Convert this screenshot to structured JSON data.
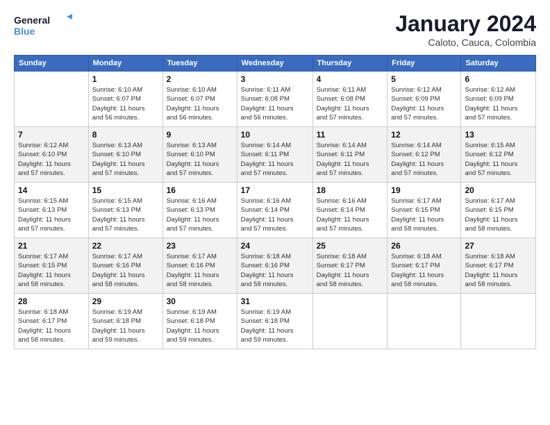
{
  "logo": {
    "line1": "General",
    "line2": "Blue"
  },
  "title": "January 2024",
  "location": "Caloto, Cauca, Colombia",
  "weekdays": [
    "Sunday",
    "Monday",
    "Tuesday",
    "Wednesday",
    "Thursday",
    "Friday",
    "Saturday"
  ],
  "weeks": [
    [
      {
        "day": "",
        "info": ""
      },
      {
        "day": "1",
        "info": "Sunrise: 6:10 AM\nSunset: 6:07 PM\nDaylight: 11 hours\nand 56 minutes."
      },
      {
        "day": "2",
        "info": "Sunrise: 6:10 AM\nSunset: 6:07 PM\nDaylight: 11 hours\nand 56 minutes."
      },
      {
        "day": "3",
        "info": "Sunrise: 6:11 AM\nSunset: 6:08 PM\nDaylight: 11 hours\nand 56 minutes."
      },
      {
        "day": "4",
        "info": "Sunrise: 6:11 AM\nSunset: 6:08 PM\nDaylight: 11 hours\nand 57 minutes."
      },
      {
        "day": "5",
        "info": "Sunrise: 6:12 AM\nSunset: 6:09 PM\nDaylight: 11 hours\nand 57 minutes."
      },
      {
        "day": "6",
        "info": "Sunrise: 6:12 AM\nSunset: 6:09 PM\nDaylight: 11 hours\nand 57 minutes."
      }
    ],
    [
      {
        "day": "7",
        "info": "Sunrise: 6:12 AM\nSunset: 6:10 PM\nDaylight: 11 hours\nand 57 minutes."
      },
      {
        "day": "8",
        "info": "Sunrise: 6:13 AM\nSunset: 6:10 PM\nDaylight: 11 hours\nand 57 minutes."
      },
      {
        "day": "9",
        "info": "Sunrise: 6:13 AM\nSunset: 6:10 PM\nDaylight: 11 hours\nand 57 minutes."
      },
      {
        "day": "10",
        "info": "Sunrise: 6:14 AM\nSunset: 6:11 PM\nDaylight: 11 hours\nand 57 minutes."
      },
      {
        "day": "11",
        "info": "Sunrise: 6:14 AM\nSunset: 6:11 PM\nDaylight: 11 hours\nand 57 minutes."
      },
      {
        "day": "12",
        "info": "Sunrise: 6:14 AM\nSunset: 6:12 PM\nDaylight: 11 hours\nand 57 minutes."
      },
      {
        "day": "13",
        "info": "Sunrise: 6:15 AM\nSunset: 6:12 PM\nDaylight: 11 hours\nand 57 minutes."
      }
    ],
    [
      {
        "day": "14",
        "info": "Sunrise: 6:15 AM\nSunset: 6:13 PM\nDaylight: 11 hours\nand 57 minutes."
      },
      {
        "day": "15",
        "info": "Sunrise: 6:15 AM\nSunset: 6:13 PM\nDaylight: 11 hours\nand 57 minutes."
      },
      {
        "day": "16",
        "info": "Sunrise: 6:16 AM\nSunset: 6:13 PM\nDaylight: 11 hours\nand 57 minutes."
      },
      {
        "day": "17",
        "info": "Sunrise: 6:16 AM\nSunset: 6:14 PM\nDaylight: 11 hours\nand 57 minutes."
      },
      {
        "day": "18",
        "info": "Sunrise: 6:16 AM\nSunset: 6:14 PM\nDaylight: 11 hours\nand 57 minutes."
      },
      {
        "day": "19",
        "info": "Sunrise: 6:17 AM\nSunset: 6:15 PM\nDaylight: 11 hours\nand 58 minutes."
      },
      {
        "day": "20",
        "info": "Sunrise: 6:17 AM\nSunset: 6:15 PM\nDaylight: 11 hours\nand 58 minutes."
      }
    ],
    [
      {
        "day": "21",
        "info": "Sunrise: 6:17 AM\nSunset: 6:15 PM\nDaylight: 11 hours\nand 58 minutes."
      },
      {
        "day": "22",
        "info": "Sunrise: 6:17 AM\nSunset: 6:16 PM\nDaylight: 11 hours\nand 58 minutes."
      },
      {
        "day": "23",
        "info": "Sunrise: 6:17 AM\nSunset: 6:16 PM\nDaylight: 11 hours\nand 58 minutes."
      },
      {
        "day": "24",
        "info": "Sunrise: 6:18 AM\nSunset: 6:16 PM\nDaylight: 11 hours\nand 58 minutes."
      },
      {
        "day": "25",
        "info": "Sunrise: 6:18 AM\nSunset: 6:17 PM\nDaylight: 11 hours\nand 58 minutes."
      },
      {
        "day": "26",
        "info": "Sunrise: 6:18 AM\nSunset: 6:17 PM\nDaylight: 11 hours\nand 58 minutes."
      },
      {
        "day": "27",
        "info": "Sunrise: 6:18 AM\nSunset: 6:17 PM\nDaylight: 11 hours\nand 58 minutes."
      }
    ],
    [
      {
        "day": "28",
        "info": "Sunrise: 6:18 AM\nSunset: 6:17 PM\nDaylight: 11 hours\nand 58 minutes."
      },
      {
        "day": "29",
        "info": "Sunrise: 6:19 AM\nSunset: 6:18 PM\nDaylight: 11 hours\nand 59 minutes."
      },
      {
        "day": "30",
        "info": "Sunrise: 6:19 AM\nSunset: 6:18 PM\nDaylight: 11 hours\nand 59 minutes."
      },
      {
        "day": "31",
        "info": "Sunrise: 6:19 AM\nSunset: 6:18 PM\nDaylight: 11 hours\nand 59 minutes."
      },
      {
        "day": "",
        "info": ""
      },
      {
        "day": "",
        "info": ""
      },
      {
        "day": "",
        "info": ""
      }
    ]
  ]
}
